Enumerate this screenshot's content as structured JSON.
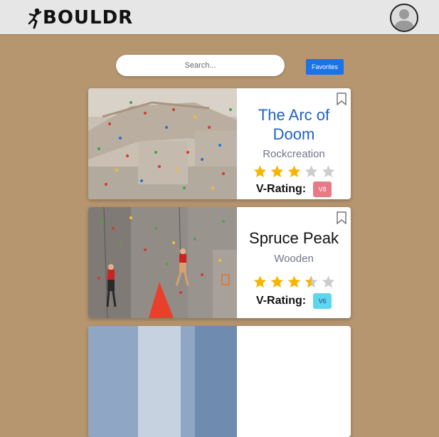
{
  "app": {
    "name": "BOULDR"
  },
  "search": {
    "placeholder": "Search..."
  },
  "favorites_label": "Favorites",
  "vrating_label": "V-Rating:",
  "routes": [
    {
      "name": "The Arc of Doom",
      "gym": "Rockcreation",
      "stars": 3,
      "max_stars": 5,
      "grade": "V8",
      "name_color": "#1e63c4",
      "grade_color": "#e87a86"
    },
    {
      "name": "Spruce Peak",
      "gym": "Wooden",
      "stars": 3.5,
      "max_stars": 5,
      "grade": "V6",
      "name_color": "#111111",
      "grade_color": "#5fd6f0"
    }
  ],
  "colors": {
    "background": "#b6966f",
    "topbar": "#e6e6e6",
    "accent": "#1a73e8",
    "star_filled": "#f7b500",
    "star_empty": "#cccccc"
  }
}
